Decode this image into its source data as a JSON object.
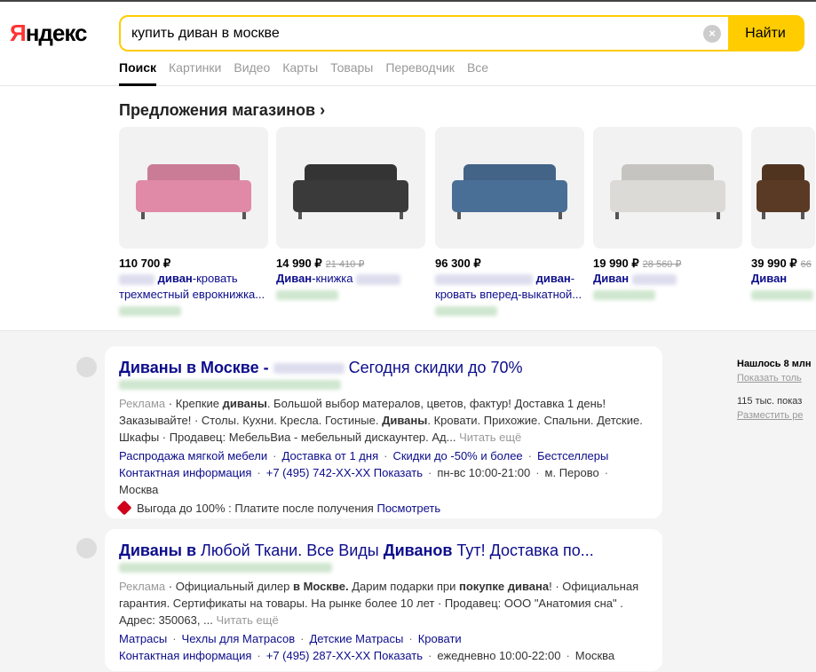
{
  "header": {
    "logo": "Яндекс",
    "query": "купить диван в москве",
    "find": "Найти",
    "clear_icon": "×",
    "tabs": [
      "Поиск",
      "Картинки",
      "Видео",
      "Карты",
      "Товары",
      "Переводчик",
      "Все"
    ]
  },
  "shops": {
    "title": "Предложения магазинов",
    "chevron": "›",
    "items": [
      {
        "price": "110 700 ₽",
        "old": "",
        "name_bold": "диван",
        "name": "-кровать трехместный еврокнижка..."
      },
      {
        "price": "14 990 ₽",
        "old": "21 410 ₽",
        "name_bold": "Диван",
        "name": "-книжка"
      },
      {
        "price": "96 300 ₽",
        "old": "",
        "name_bold": "диван",
        "name": "-кровать вперед-выкатной..."
      },
      {
        "price": "19 990 ₽",
        "old": "28 560 ₽",
        "name_bold": "Диван",
        "name": ""
      },
      {
        "price": "39 990 ₽",
        "old": "66",
        "name_bold": "Диван",
        "name": ""
      }
    ]
  },
  "results": [
    {
      "title_a": "Диваны в Москве - ",
      "title_b": "Сегодня скидки до 70%",
      "ad": "Реклама",
      "t1": " · Крепкие ",
      "b1": "диваны",
      "t2": ". Большой выбор матералов, цветов, фактур! Доставка 1 день! Заказывайте! · Столы. Кухни. Кресла. Гостиные. ",
      "b2": "Диваны",
      "t3": ". Кровати. Прихожие. Спальни. Детские. Шкафы · Продавец: МебельВиа - мебельный дискаунтер. Ад...",
      "more": "Читать ещё",
      "links": [
        "Распродажа мягкой мебели",
        "Доставка от 1 дня",
        "Скидки до -50% и более",
        "Бестселлеры"
      ],
      "contact": [
        "Контактная информация",
        "+7 (495) 742-XX-XX Показать",
        "пн-вс 10:00-21:00",
        "м. Перово",
        "Москва"
      ],
      "promo": "Выгода до 100% : Платите после получения",
      "promo_link": "Посмотреть"
    },
    {
      "t_a": "Диваны в",
      "t_b": " Любой Ткани. Все Виды ",
      "t_c": "Диванов",
      "t_d": " Тут! Доставка по...",
      "ad": "Реклама",
      "t1": " · Официальный дилер ",
      "b1": "в Москве.",
      "t2": " Дарим подарки при ",
      "b2": "покупке дивана",
      "t3": "! · Официальная гарантия. Сертификаты на товары. На рынке более 10 лет · Продавец: ООО \"Анатомия сна\" . Адрес: 350063, ...",
      "more": "Читать ещё",
      "links": [
        "Матрасы",
        "Чехлы для Матрасов",
        "Детские Матрасы",
        "Кровати"
      ],
      "contact": [
        "Контактная информация",
        "+7 (495) 287-XX-XX Показать",
        "ежедневно 10:00-22:00",
        "Москва"
      ]
    }
  ],
  "right": {
    "found": "Нашлось 8 млн",
    "only": "Показать толь",
    "shows": "115 тыс. показ",
    "place": "Разместить ре"
  },
  "colors": {
    "accent": "#ffcc00",
    "link": "#0c0c8c",
    "sofas": [
      "#e08aa8",
      "#3a3a3a",
      "#4a6f96",
      "#dcdad6",
      "#5a3a24"
    ]
  }
}
